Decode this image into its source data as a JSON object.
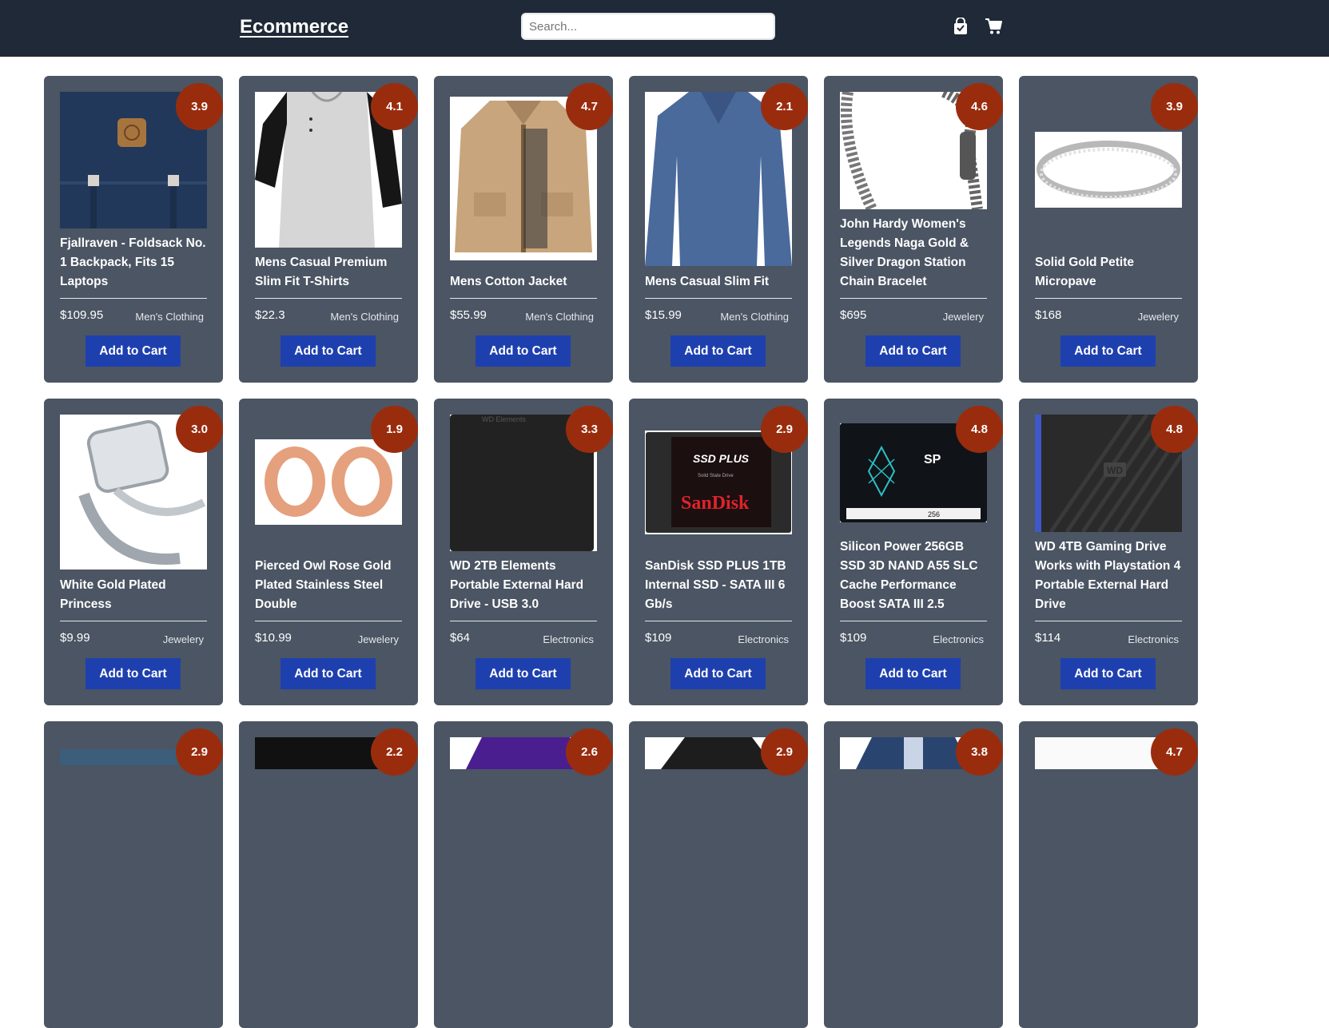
{
  "header": {
    "brand": "Ecommerce",
    "search_placeholder": "Search...",
    "bag_icon": "shopping-bag-icon",
    "cart_icon": "cart-icon"
  },
  "colors": {
    "navbar": "#1f2937",
    "card": "#4b5563",
    "rating_badge": "#9a2c0e",
    "button": "#1e40af"
  },
  "button_label": "Add to Cart",
  "products": [
    {
      "title": "Fjallraven - Foldsack No. 1 Backpack, Fits 15 Laptops",
      "price": "$109.95",
      "category": "Men's Clothing",
      "rating": "3.9",
      "image": "backpack"
    },
    {
      "title": "Mens Casual Premium Slim Fit T-Shirts",
      "price": "$22.3",
      "category": "Men's Clothing",
      "rating": "4.1",
      "image": "raglan-tshirt"
    },
    {
      "title": "Mens Cotton Jacket",
      "price": "$55.99",
      "category": "Men's Clothing",
      "rating": "4.7",
      "image": "cotton-jacket"
    },
    {
      "title": "Mens Casual Slim Fit",
      "price": "$15.99",
      "category": "Men's Clothing",
      "rating": "2.1",
      "image": "blue-long-sleeve"
    },
    {
      "title": "John Hardy Women's Legends Naga Gold & Silver Dragon Station Chain Bracelet",
      "price": "$695",
      "category": "Jewelery",
      "rating": "4.6",
      "image": "dragon-bracelet"
    },
    {
      "title": "Solid Gold Petite Micropave",
      "price": "$168",
      "category": "Jewelery",
      "rating": "3.9",
      "image": "micropave-ring"
    },
    {
      "title": "White Gold Plated Princess",
      "price": "$9.99",
      "category": "Jewelery",
      "rating": "3.0",
      "image": "princess-ring"
    },
    {
      "title": "Pierced Owl Rose Gold Plated Stainless Steel Double",
      "price": "$10.99",
      "category": "Jewelery",
      "rating": "1.9",
      "image": "rose-gold-plugs"
    },
    {
      "title": "WD 2TB Elements Portable External Hard Drive - USB 3.0",
      "price": "$64",
      "category": "Electronics",
      "rating": "3.3",
      "image": "wd-elements-drive"
    },
    {
      "title": "SanDisk SSD PLUS 1TB Internal SSD - SATA III 6 Gb/s",
      "price": "$109",
      "category": "Electronics",
      "rating": "2.9",
      "image": "sandisk-ssd"
    },
    {
      "title": "Silicon Power 256GB SSD 3D NAND A55 SLC Cache Performance Boost SATA III 2.5",
      "price": "$109",
      "category": "Electronics",
      "rating": "4.8",
      "image": "silicon-power-ssd"
    },
    {
      "title": "WD 4TB Gaming Drive Works with Playstation 4 Portable External Hard Drive",
      "price": "$114",
      "category": "Electronics",
      "rating": "4.8",
      "image": "wd-gaming-drive"
    },
    {
      "title": "",
      "price": "",
      "category": "",
      "rating": "2.9",
      "image": "monitor"
    },
    {
      "title": "",
      "price": "",
      "category": "",
      "rating": "2.2",
      "image": "monitor-dark"
    },
    {
      "title": "",
      "price": "",
      "category": "",
      "rating": "2.6",
      "image": "purple-jacket"
    },
    {
      "title": "",
      "price": "",
      "category": "",
      "rating": "2.9",
      "image": "leather-jacket"
    },
    {
      "title": "",
      "price": "",
      "category": "",
      "rating": "3.8",
      "image": "raincoat"
    },
    {
      "title": "",
      "price": "",
      "category": "",
      "rating": "4.7",
      "image": "white-top"
    }
  ],
  "image_text": {
    "sandisk_top": "SSD PLUS",
    "sandisk_sub": "Solid State Drive",
    "sandisk_brand": "SanDisk",
    "sp_logo": "SP",
    "sp_capacity": "256",
    "wd_badge": "WD",
    "wd_elements": "WD Elements"
  }
}
